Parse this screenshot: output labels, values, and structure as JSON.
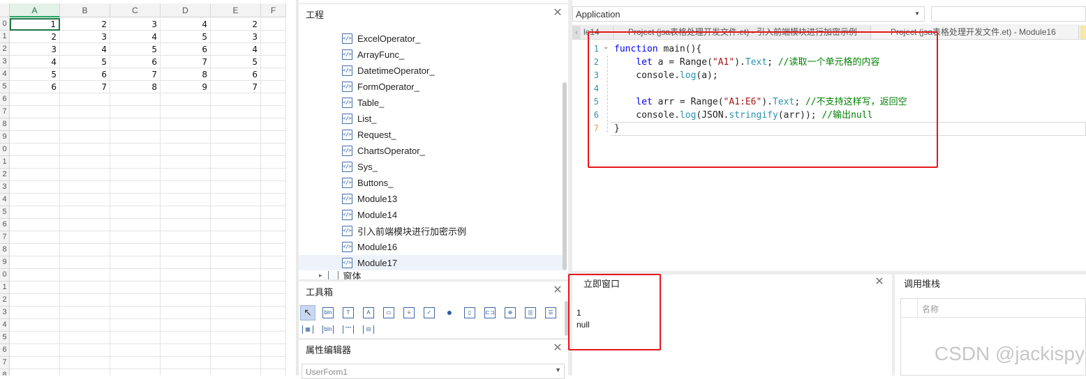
{
  "sheet": {
    "columns": [
      "A",
      "B",
      "C",
      "D",
      "E",
      "F"
    ],
    "row_numbers": [
      "0",
      "1",
      "2",
      "3",
      "4",
      "5",
      "6",
      "7",
      "8",
      "9",
      "0",
      "1",
      "2",
      "3",
      "4",
      "5",
      "6",
      "7",
      "8",
      "9",
      "0",
      "1",
      "2",
      "3",
      "4",
      "5",
      "6",
      "7",
      "8",
      "9"
    ],
    "cells": [
      [
        "1",
        "2",
        "3",
        "4",
        "2"
      ],
      [
        "2",
        "3",
        "4",
        "5",
        "3"
      ],
      [
        "3",
        "4",
        "5",
        "6",
        "4"
      ],
      [
        "4",
        "5",
        "6",
        "7",
        "5"
      ],
      [
        "5",
        "6",
        "7",
        "8",
        "6"
      ],
      [
        "6",
        "7",
        "8",
        "9",
        "7"
      ]
    ]
  },
  "project_pane": {
    "title": "工程",
    "items": [
      "ExcelOperator_",
      "ArrayFunc_",
      "DatetimeOperator_",
      "FormOperator_",
      "Table_",
      "List_",
      "Request_",
      "ChartsOperator_",
      "Sys_",
      "Buttons_",
      "Module13",
      "Module14",
      "引入前端模块进行加密示例",
      "Module16",
      "Module17"
    ],
    "partial_item": "窗体"
  },
  "toolbox": {
    "title": "工具箱",
    "tools": [
      "pointer-tool",
      "textbox-tool",
      "label-tool",
      "image-label-tool",
      "frame-tool",
      "listbox-tool",
      "checkbox-tool",
      "radio-tool",
      "toggle-tool",
      "spin-tool",
      "center-tool",
      "barcode-tool",
      "align-tool"
    ],
    "tools_row2": [
      "multipage-tool",
      "combo-tool",
      "quote-tool",
      "tabstrip-tool"
    ]
  },
  "property_editor": {
    "title": "属性编辑器",
    "selected": "UserForm1"
  },
  "editor": {
    "object_dropdown": "Application",
    "tabs": [
      "le14",
      "Project (jsa表格处理开发文件.et) - 引入前端模块进行加密示例",
      "Project (jsa表格处理开发文件.et) - Module16"
    ],
    "lines": [
      {
        "n": "1",
        "parts": [
          {
            "t": "function ",
            "c": "kw"
          },
          {
            "t": "main",
            "c": ""
          },
          {
            "t": "(){",
            "c": ""
          }
        ]
      },
      {
        "n": "2",
        "parts": [
          {
            "t": "    let ",
            "c": "kw"
          },
          {
            "t": "a = Range(",
            "c": ""
          },
          {
            "t": "\"A1\"",
            "c": "str"
          },
          {
            "t": ").",
            "c": ""
          },
          {
            "t": "Text",
            "c": "prop"
          },
          {
            "t": "; ",
            "c": ""
          },
          {
            "t": "//读取一个单元格的内容",
            "c": "cm"
          }
        ]
      },
      {
        "n": "3",
        "parts": [
          {
            "t": "    console.",
            "c": ""
          },
          {
            "t": "log",
            "c": "prop"
          },
          {
            "t": "(a);",
            "c": ""
          }
        ]
      },
      {
        "n": "4",
        "parts": []
      },
      {
        "n": "5",
        "parts": [
          {
            "t": "    let ",
            "c": "kw"
          },
          {
            "t": "arr = Range(",
            "c": ""
          },
          {
            "t": "\"A1:E6\"",
            "c": "str"
          },
          {
            "t": ").",
            "c": ""
          },
          {
            "t": "Text",
            "c": "prop"
          },
          {
            "t": "; ",
            "c": ""
          },
          {
            "t": "//不支持这样写，返回空",
            "c": "cm"
          }
        ]
      },
      {
        "n": "6",
        "parts": [
          {
            "t": "    console.",
            "c": ""
          },
          {
            "t": "log",
            "c": "prop"
          },
          {
            "t": "(JSON.",
            "c": ""
          },
          {
            "t": "stringify",
            "c": "prop"
          },
          {
            "t": "(arr)); ",
            "c": ""
          },
          {
            "t": "//输出null",
            "c": "cm"
          }
        ]
      },
      {
        "n": "7",
        "parts": [
          {
            "t": "}",
            "c": ""
          }
        ]
      }
    ]
  },
  "immediate": {
    "title": "立即窗口",
    "output": [
      "1",
      "null"
    ]
  },
  "callstack": {
    "title": "调用堆栈",
    "column": "名称"
  },
  "watermark": "CSDN @jackispy",
  "colors": {
    "highlight_red": "#e8141a",
    "excel_green": "#217346",
    "keyword_blue": "#0000ff",
    "comment_green": "#008000",
    "string_red": "#a31515"
  }
}
